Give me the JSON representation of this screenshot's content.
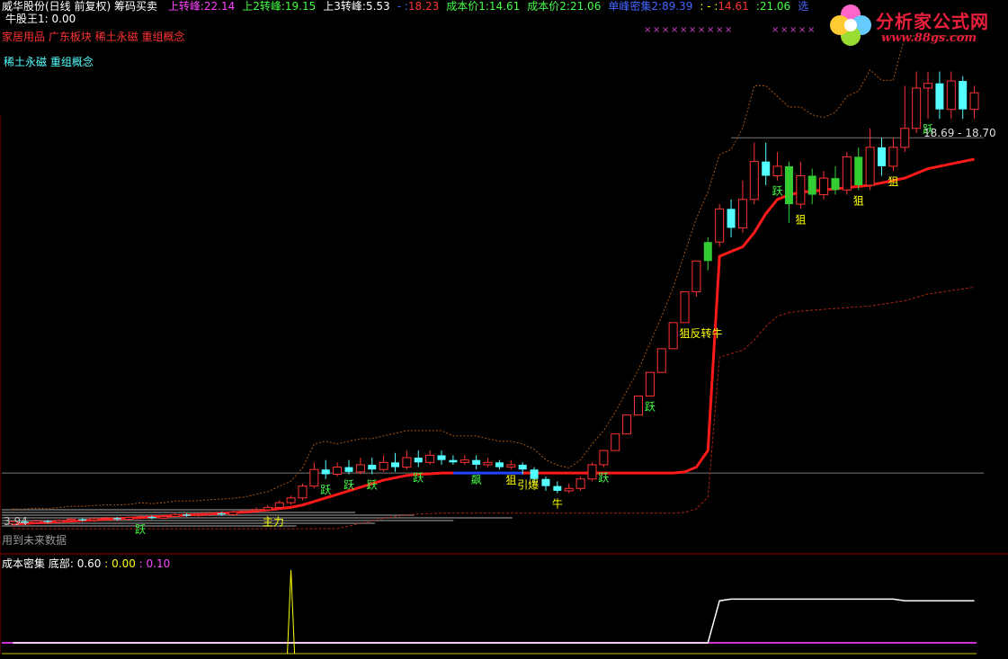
{
  "header": {
    "title": "威华股份(日线 前复权) 筹码买卖",
    "indicators": [
      {
        "label": "上转峰:",
        "value": "22.14",
        "label_color": "#ff44ff",
        "value_color": "#ff44ff"
      },
      {
        "label": "上2转峰:",
        "value": "19.15",
        "label_color": "#44ff44",
        "value_color": "#44ff44"
      },
      {
        "label": "上3转峰:",
        "value": "5.53",
        "label_color": "#ffffff",
        "value_color": "#ffffff"
      },
      {
        "label": "- :",
        "value": "18.23",
        "label_color": "#4466ff",
        "value_color": "#ff3333"
      },
      {
        "label": "成本价1:",
        "value": "14.61",
        "label_color": "#44ff44",
        "value_color": "#44ff44"
      },
      {
        "label": "成本价2:",
        "value": "21.06",
        "label_color": "#44ff44",
        "value_color": "#44ff44"
      },
      {
        "label": "单峰密集2:",
        "value": "89.39",
        "label_color": "#4466ff",
        "value_color": "#4466ff"
      },
      {
        "label": ": - :",
        "value": "14.61",
        "label_color": "#ffff00",
        "value_color": "#ff3333"
      },
      {
        "label": ":",
        "value": "21.06",
        "label_color": "#44ff44",
        "value_color": "#44ff44"
      },
      {
        "label": "选",
        "value": "",
        "label_color": "#4466ff",
        "value_color": "#4466ff"
      }
    ],
    "subtitle": "牛股王1: 0.00"
  },
  "concepts": {
    "line1": "家居用品 广东板块 稀土永磁 重组概念",
    "line2": "稀土永磁 重组概念"
  },
  "watermark": {
    "title": "分析家公式网",
    "url": "www.88gs.com"
  },
  "main_labels": {
    "price_low": "3.94",
    "range_label": "18.69 - 18.70",
    "future_note": "用到未来数据"
  },
  "sub_panel": {
    "title": "成本密集",
    "bottom_label": "底部:",
    "v1": "0.60",
    "v2": "0.00",
    "v3": "0.10",
    "v1_color": "#ffffff",
    "v2_color": "#ffff00",
    "v3_color": "#ff44ff"
  },
  "chart_data": {
    "type": "candlestick",
    "candles": [
      [
        3.9,
        4.0,
        3.85,
        4.05
      ],
      [
        4.0,
        3.95,
        3.9,
        4.05
      ],
      [
        3.95,
        4.02,
        3.9,
        4.08
      ],
      [
        4.02,
        3.98,
        3.93,
        4.06
      ],
      [
        3.98,
        4.05,
        3.95,
        4.1
      ],
      [
        4.05,
        4.1,
        4.0,
        4.15
      ],
      [
        4.1,
        4.05,
        4.0,
        4.15
      ],
      [
        4.05,
        4.12,
        4.0,
        4.18
      ],
      [
        4.12,
        4.15,
        4.08,
        4.2
      ],
      [
        4.15,
        4.1,
        4.05,
        4.2
      ],
      [
        4.1,
        4.18,
        4.05,
        4.22
      ],
      [
        4.18,
        4.2,
        4.12,
        4.28
      ],
      [
        4.2,
        4.15,
        4.1,
        4.25
      ],
      [
        4.15,
        4.22,
        4.1,
        4.28
      ],
      [
        4.22,
        4.3,
        4.18,
        4.35
      ],
      [
        4.3,
        4.25,
        4.2,
        4.35
      ],
      [
        4.25,
        4.3,
        4.2,
        4.36
      ],
      [
        4.3,
        4.35,
        4.25,
        4.4
      ],
      [
        4.35,
        4.3,
        4.25,
        4.42
      ],
      [
        4.3,
        4.4,
        4.25,
        4.45
      ],
      [
        4.4,
        4.45,
        4.35,
        4.5
      ],
      [
        4.45,
        4.5,
        4.4,
        4.6
      ],
      [
        4.5,
        4.6,
        4.45,
        4.7
      ],
      [
        4.6,
        4.8,
        4.55,
        4.9
      ],
      [
        4.8,
        5.0,
        4.7,
        5.1
      ],
      [
        5.0,
        5.5,
        4.9,
        5.6
      ],
      [
        5.5,
        6.2,
        5.4,
        6.5
      ],
      [
        6.2,
        6.0,
        5.8,
        6.6
      ],
      [
        6.0,
        6.3,
        5.9,
        6.5
      ],
      [
        6.3,
        6.1,
        6.0,
        6.6
      ],
      [
        6.1,
        6.4,
        6.0,
        6.7
      ],
      [
        6.4,
        6.2,
        6.0,
        6.7
      ],
      [
        6.2,
        6.5,
        6.1,
        6.8
      ],
      [
        6.5,
        6.3,
        6.1,
        6.9
      ],
      [
        6.3,
        6.7,
        6.2,
        7.0
      ],
      [
        6.7,
        6.5,
        6.3,
        7.0
      ],
      [
        6.5,
        6.8,
        6.4,
        7.0
      ],
      [
        6.8,
        6.6,
        6.4,
        7.0
      ],
      [
        6.6,
        6.5,
        6.4,
        6.8
      ],
      [
        6.5,
        6.6,
        6.4,
        6.8
      ],
      [
        6.6,
        6.4,
        6.2,
        6.8
      ],
      [
        6.4,
        6.5,
        6.3,
        6.7
      ],
      [
        6.5,
        6.3,
        6.2,
        6.6
      ],
      [
        6.3,
        6.4,
        6.2,
        6.6
      ],
      [
        6.4,
        6.2,
        6.0,
        6.5
      ],
      [
        6.2,
        5.8,
        5.6,
        6.3
      ],
      [
        5.8,
        5.5,
        5.3,
        5.9
      ],
      [
        5.5,
        5.3,
        5.2,
        5.7
      ],
      [
        5.3,
        5.4,
        5.2,
        5.6
      ],
      [
        5.4,
        5.8,
        5.3,
        5.9
      ],
      [
        5.8,
        6.4,
        5.7,
        6.5
      ],
      [
        6.4,
        7.0,
        6.3,
        7.0
      ],
      [
        7.0,
        7.7,
        7.0,
        7.7
      ],
      [
        7.7,
        8.5,
        7.7,
        8.5
      ],
      [
        8.5,
        9.3,
        8.5,
        9.3
      ],
      [
        9.3,
        10.3,
        9.3,
        10.3
      ],
      [
        10.3,
        11.3,
        10.3,
        11.3
      ],
      [
        11.3,
        12.4,
        11.3,
        12.4
      ],
      [
        12.4,
        13.7,
        12.4,
        13.7
      ],
      [
        13.7,
        15.0,
        13.5,
        15.0
      ],
      [
        15.0,
        15.8,
        14.6,
        16.0
      ],
      [
        15.8,
        17.2,
        15.6,
        17.4
      ],
      [
        17.2,
        16.4,
        16.0,
        17.6
      ],
      [
        16.4,
        17.6,
        16.2,
        18.4
      ],
      [
        17.6,
        19.2,
        17.4,
        20.0
      ],
      [
        19.2,
        18.6,
        18.2,
        20.0
      ],
      [
        18.6,
        19.0,
        18.4,
        19.6
      ],
      [
        19.0,
        17.4,
        16.6,
        19.2
      ],
      [
        17.4,
        18.6,
        17.2,
        19.2
      ],
      [
        18.6,
        17.8,
        17.4,
        18.9
      ],
      [
        17.8,
        18.5,
        17.6,
        18.8
      ],
      [
        18.5,
        18.0,
        17.8,
        19.0
      ],
      [
        18.0,
        19.4,
        17.8,
        19.6
      ],
      [
        19.4,
        18.2,
        18.0,
        19.8
      ],
      [
        18.2,
        19.8,
        18.0,
        20.6
      ],
      [
        19.8,
        19.0,
        18.6,
        20.2
      ],
      [
        19.0,
        19.8,
        18.8,
        20.2
      ],
      [
        19.8,
        20.6,
        19.6,
        22.4
      ],
      [
        20.6,
        22.3,
        20.4,
        23.0
      ],
      [
        22.3,
        22.5,
        21.0,
        23.0
      ],
      [
        22.5,
        21.4,
        21.0,
        23.0
      ],
      [
        21.4,
        22.6,
        21.0,
        23.0
      ],
      [
        22.6,
        21.4,
        21.0,
        22.8
      ],
      [
        21.4,
        22.1,
        21.0,
        22.4
      ]
    ],
    "cost_line": [
      3.9,
      3.92,
      3.95,
      3.97,
      4.0,
      4.02,
      4.05,
      4.07,
      4.1,
      4.12,
      4.15,
      4.17,
      4.2,
      4.22,
      4.25,
      4.28,
      4.3,
      4.32,
      4.35,
      4.38,
      4.4,
      4.45,
      4.5,
      4.55,
      4.6,
      4.7,
      4.85,
      5.0,
      5.15,
      5.3,
      5.45,
      5.6,
      5.75,
      5.85,
      5.95,
      6.0,
      6.02,
      6.05,
      6.05,
      6.05,
      6.05,
      6.05,
      6.05,
      6.05,
      6.05,
      6.05,
      6.05,
      6.05,
      6.05,
      6.05,
      6.05,
      6.05,
      6.05,
      6.05,
      6.05,
      6.05,
      6.05,
      6.05,
      6.1,
      6.3,
      7.0,
      15.2,
      15.4,
      15.6,
      16.2,
      17.0,
      17.6,
      17.8,
      17.9,
      17.95,
      18.0,
      18.05,
      18.1,
      18.15,
      18.2,
      18.3,
      18.4,
      18.5,
      18.7,
      18.9,
      19.0,
      19.1,
      19.2,
      19.3
    ],
    "sub_series": [
      0.1,
      0.1,
      0.1,
      0.1,
      0.1,
      0.1,
      0.1,
      0.1,
      0.1,
      0.1,
      0.1,
      0.1,
      0.1,
      0.1,
      0.1,
      0.1,
      0.1,
      0.1,
      0.1,
      0.1,
      0.1,
      0.1,
      0.1,
      0.1,
      0.1,
      0.1,
      0.1,
      0.1,
      0.1,
      0.1,
      0.1,
      0.1,
      0.1,
      0.1,
      0.1,
      0.1,
      0.1,
      0.1,
      0.1,
      0.1,
      0.1,
      0.1,
      0.1,
      0.1,
      0.1,
      0.1,
      0.1,
      0.1,
      0.1,
      0.1,
      0.1,
      0.1,
      0.1,
      0.1,
      0.1,
      0.1,
      0.1,
      0.1,
      0.1,
      0.1,
      0.1,
      0.62,
      0.64,
      0.64,
      0.64,
      0.64,
      0.64,
      0.64,
      0.64,
      0.64,
      0.64,
      0.64,
      0.64,
      0.64,
      0.64,
      0.64,
      0.64,
      0.62,
      0.62,
      0.62,
      0.62,
      0.62,
      0.62,
      0.62
    ],
    "sub_spike": {
      "index": 24,
      "value": 1.0
    },
    "signals": [
      {
        "i": 11,
        "text": "跃",
        "color": "#44ff44"
      },
      {
        "i": 35,
        "text": "跃",
        "color": "#44ff44"
      },
      {
        "i": 22,
        "text": "主力",
        "color": "#ffff00"
      },
      {
        "i": 27,
        "text": "跃",
        "color": "#44ff44"
      },
      {
        "i": 29,
        "text": "跃",
        "color": "#44ff44"
      },
      {
        "i": 31,
        "text": "跃",
        "color": "#44ff44"
      },
      {
        "i": 40,
        "text": "飙",
        "color": "#44ff44"
      },
      {
        "i": 43,
        "text": "狙",
        "color": "#ffff00"
      },
      {
        "i": 44,
        "text": "引爆",
        "color": "#ffff00"
      },
      {
        "i": 47,
        "text": "牛",
        "color": "#ffff00"
      },
      {
        "i": 51,
        "text": "跃",
        "color": "#44ff44"
      },
      {
        "i": 55,
        "text": "跃",
        "color": "#44ff44"
      },
      {
        "i": 58,
        "text": "狙反转牛",
        "color": "#ffff00"
      },
      {
        "i": 66,
        "text": "跃",
        "color": "#44ff44"
      },
      {
        "i": 68,
        "text": "狙",
        "color": "#ffff00"
      },
      {
        "i": 73,
        "text": "狙",
        "color": "#ffff00"
      },
      {
        "i": 76,
        "text": "狙",
        "color": "#ffff00"
      },
      {
        "i": 79,
        "text": "跃",
        "color": "#44ff44"
      }
    ],
    "colors": {
      "up": "#ff3333",
      "down": "#54ffff",
      "strong": "#33cc33",
      "cost_line": "#ff1a1a",
      "cost_line_dip": "#2244ff",
      "sub_line": "#ffffff",
      "sub_base": "#cc33cc",
      "frame": "#8b0000"
    },
    "ylim": [
      3.4,
      24.5
    ]
  }
}
